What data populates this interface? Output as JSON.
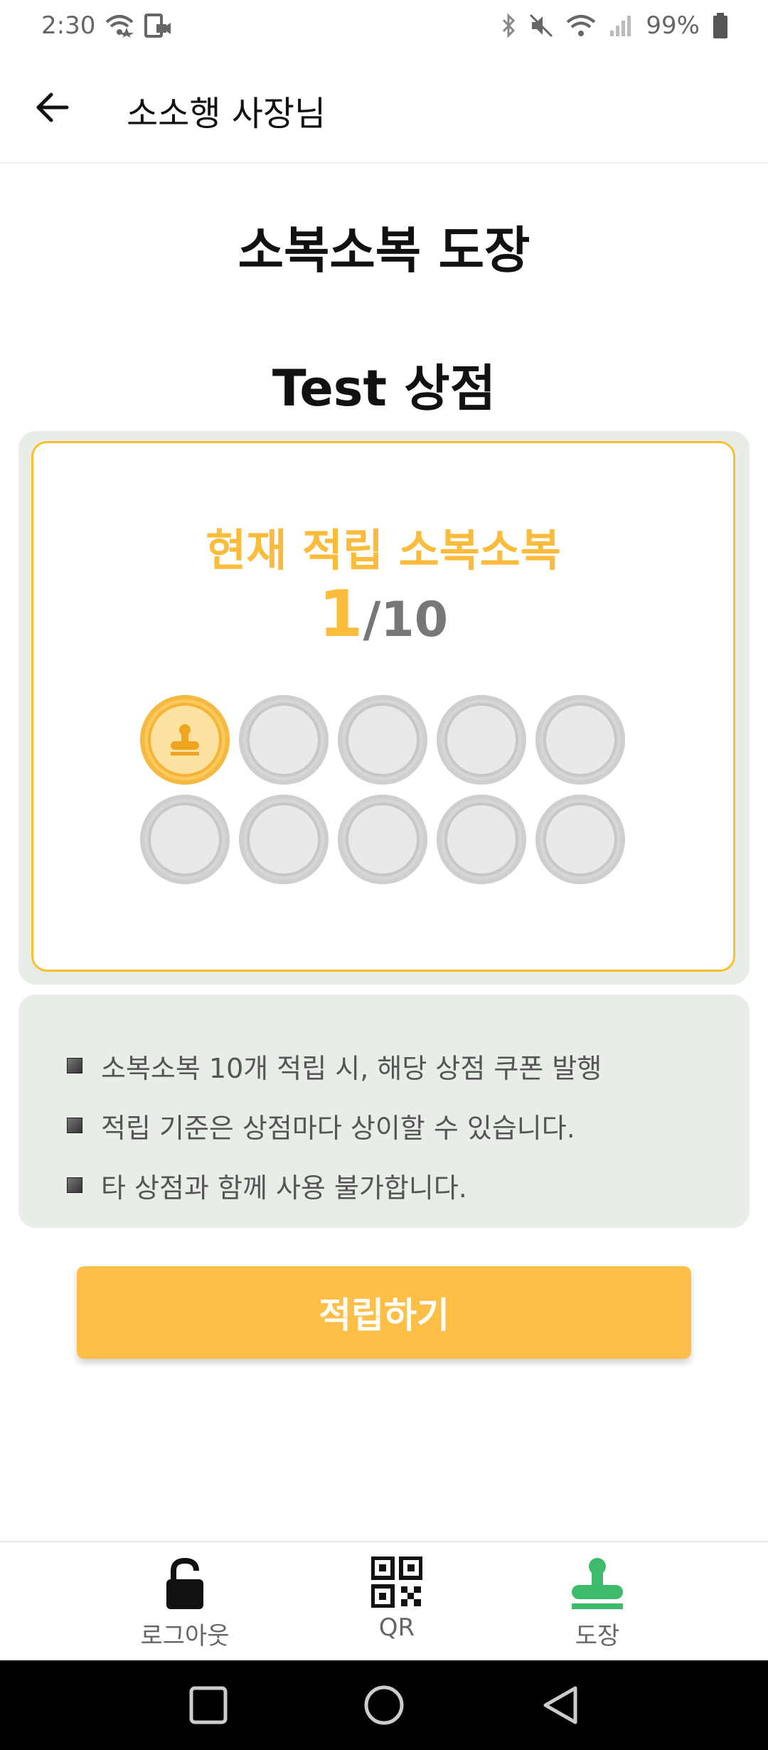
{
  "status_bar": {
    "time": "2:30",
    "battery": "99%"
  },
  "app_bar": {
    "title": "소소행 사장님"
  },
  "page_title": "소복소복 도장",
  "store_name": "Test 상점",
  "card": {
    "heading": "현재 적립 소복소복",
    "current": "1",
    "separator": "/",
    "total": "10",
    "stamps_filled": 1,
    "stamps_total": 10
  },
  "info": [
    "소복소복 10개 적립 시, 해당 상점 쿠폰 발행",
    "적립 기준은 상점마다 상이할 수 있습니다.",
    "타 상점과 함께 사용 불가합니다."
  ],
  "action_button": "적립하기",
  "bottom_nav": [
    {
      "label": "로그아웃",
      "icon": "unlock-icon"
    },
    {
      "label": "QR",
      "icon": "qr-code-icon"
    },
    {
      "label": "도장",
      "icon": "stamp-icon",
      "active": true
    }
  ],
  "colors": {
    "accent": "#fdbf47",
    "card_border": "#fbbf2d",
    "nav_active": "#3dbb6b",
    "panel_bg": "#e8ede8"
  }
}
